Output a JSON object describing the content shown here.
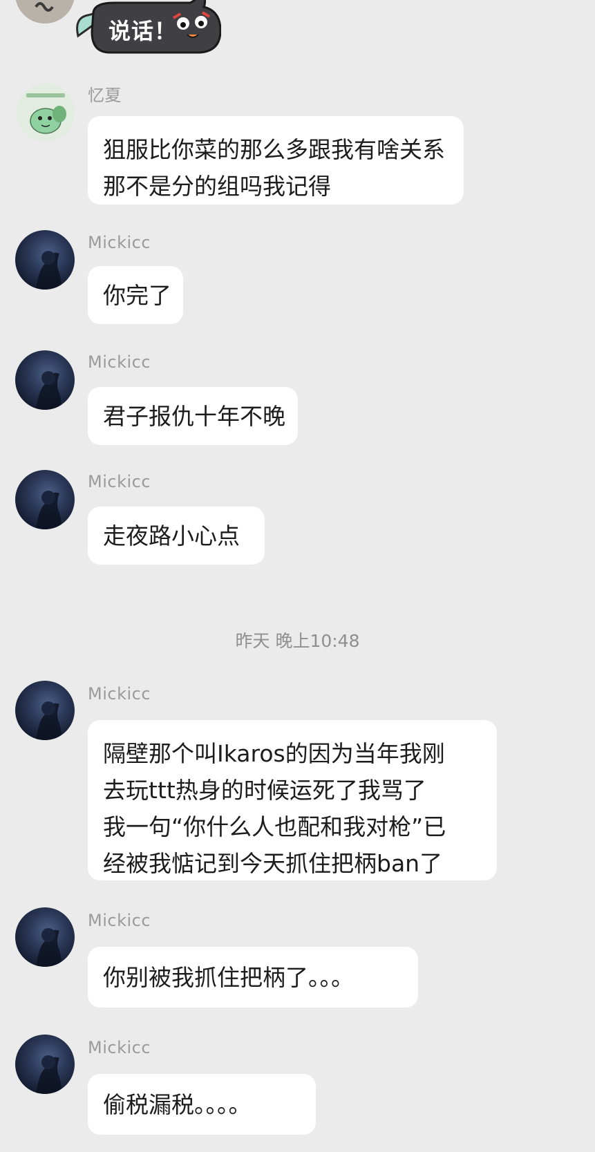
{
  "sticker": {
    "text": "说话！"
  },
  "timestamp": "昨天 晚上10:48",
  "messages": [
    {
      "sender": "忆夏",
      "lines": [
        "狙服比你菜的那么多跟我有啥关系",
        "那不是分的组吗我记得"
      ]
    },
    {
      "sender": "Mickicc",
      "lines": [
        "你完了"
      ]
    },
    {
      "sender": "Mickicc",
      "lines": [
        "君子报仇十年不晚"
      ]
    },
    {
      "sender": "Mickicc",
      "lines": [
        "走夜路小心点"
      ]
    },
    {
      "sender": "Mickicc",
      "lines": [
        "隔壁那个叫Ikaros的因为当年我刚",
        "去玩ttt热身的时候运死了我骂了",
        "我一句“你什么人也配和我对枪”已",
        "经被我惦记到今天抓住把柄ban了"
      ]
    },
    {
      "sender": "Mickicc",
      "lines": [
        "你别被我抓住把柄了。。。"
      ]
    },
    {
      "sender": "Mickicc",
      "lines": [
        "偷税漏税。。。。"
      ]
    }
  ]
}
